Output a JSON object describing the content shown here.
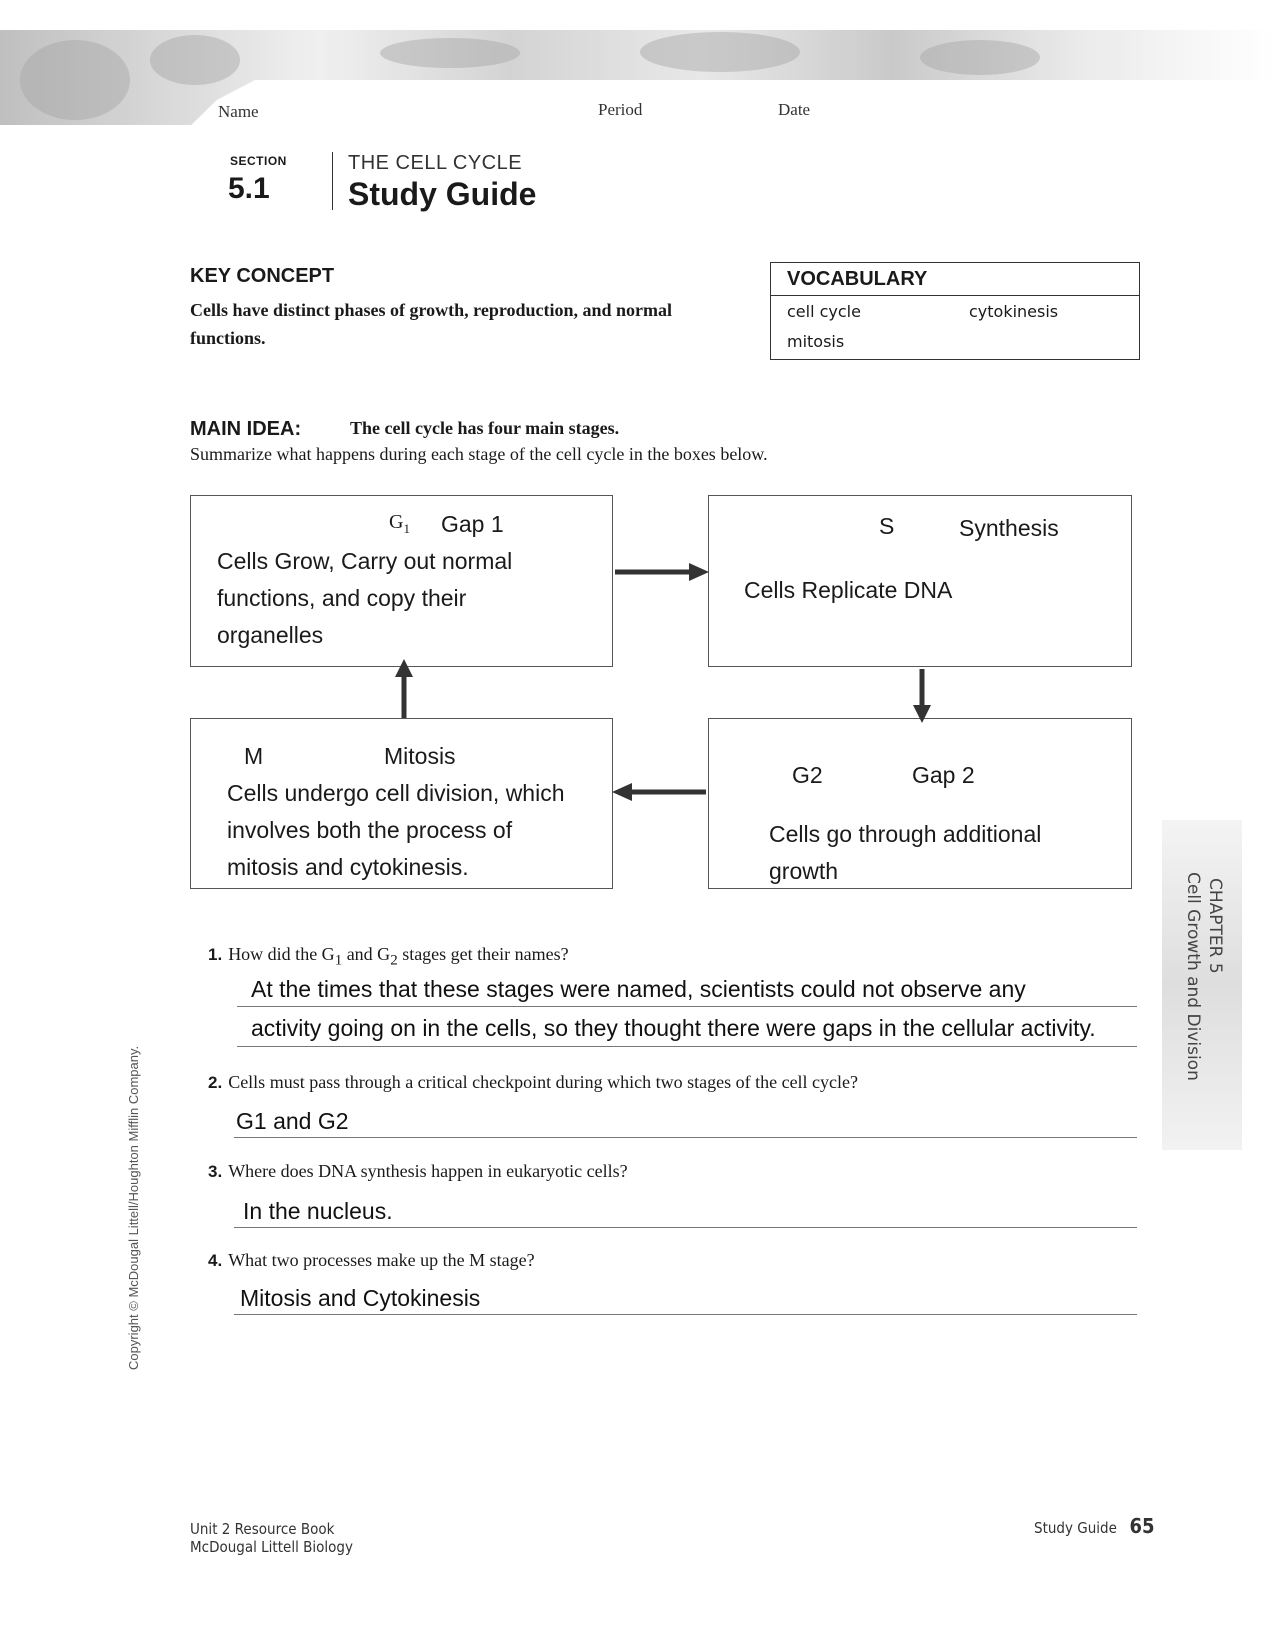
{
  "header": {
    "name_label": "Name",
    "period_label": "Period",
    "date_label": "Date"
  },
  "section": {
    "label": "SECTION",
    "number": "5.1",
    "supertitle": "THE CELL CYCLE",
    "title": "Study Guide"
  },
  "key_concept": {
    "label": "KEY CONCEPT",
    "text": "Cells have distinct phases of growth, reproduction, and normal functions."
  },
  "vocabulary": {
    "heading": "VOCABULARY",
    "terms": [
      "cell cycle",
      "cytokinesis",
      "mitosis"
    ]
  },
  "main_idea": {
    "label": "MAIN IDEA:",
    "text": "The cell cycle has four main stages.",
    "instruction": "Summarize what happens during each stage of the cell cycle in the boxes below."
  },
  "cycle_boxes": {
    "g1": {
      "symbol": "G",
      "subscript": "1",
      "name": "Gap 1",
      "answer": "Cells Grow, Carry out normal functions, and copy their organelles"
    },
    "s": {
      "symbol": "S",
      "name": "Synthesis",
      "answer": "Cells Replicate DNA"
    },
    "g2": {
      "symbol": "G2",
      "name": "Gap 2",
      "answer": "Cells go through additional growth"
    },
    "m": {
      "symbol": "M",
      "name": "Mitosis",
      "answer": "Cells undergo cell division, which involves both the process of mitosis and cytokinesis."
    }
  },
  "questions": [
    {
      "number": "1.",
      "text_pre": "How did the G",
      "sub1": "1",
      "text_mid": " and G",
      "sub2": "2",
      "text_post": " stages get their names?",
      "answer_lines": [
        "At the times that these stages were named, scientists could not observe any",
        "activity going on in the cells, so they thought there were gaps in the cellular activity."
      ]
    },
    {
      "number": "2.",
      "text": "Cells must pass through a critical checkpoint during which two stages of the cell cycle?",
      "answer_lines": [
        "G1 and G2"
      ]
    },
    {
      "number": "3.",
      "text": "Where does DNA synthesis happen in eukaryotic cells?",
      "answer_lines": [
        "In the nucleus."
      ]
    },
    {
      "number": "4.",
      "text": "What two processes make up the M stage?",
      "answer_lines": [
        "Mitosis and Cytokinesis"
      ]
    }
  ],
  "side_tab": {
    "chapter": "CHAPTER 5",
    "subtitle": "Cell Growth and Division"
  },
  "copyright": "Copyright © McDougal Littell/Houghton Mifflin Company.",
  "footer": {
    "book_line1": "Unit 2 Resource Book",
    "book_line2": "McDougal Littell Biology",
    "label": "Study Guide",
    "page_number": "65"
  }
}
